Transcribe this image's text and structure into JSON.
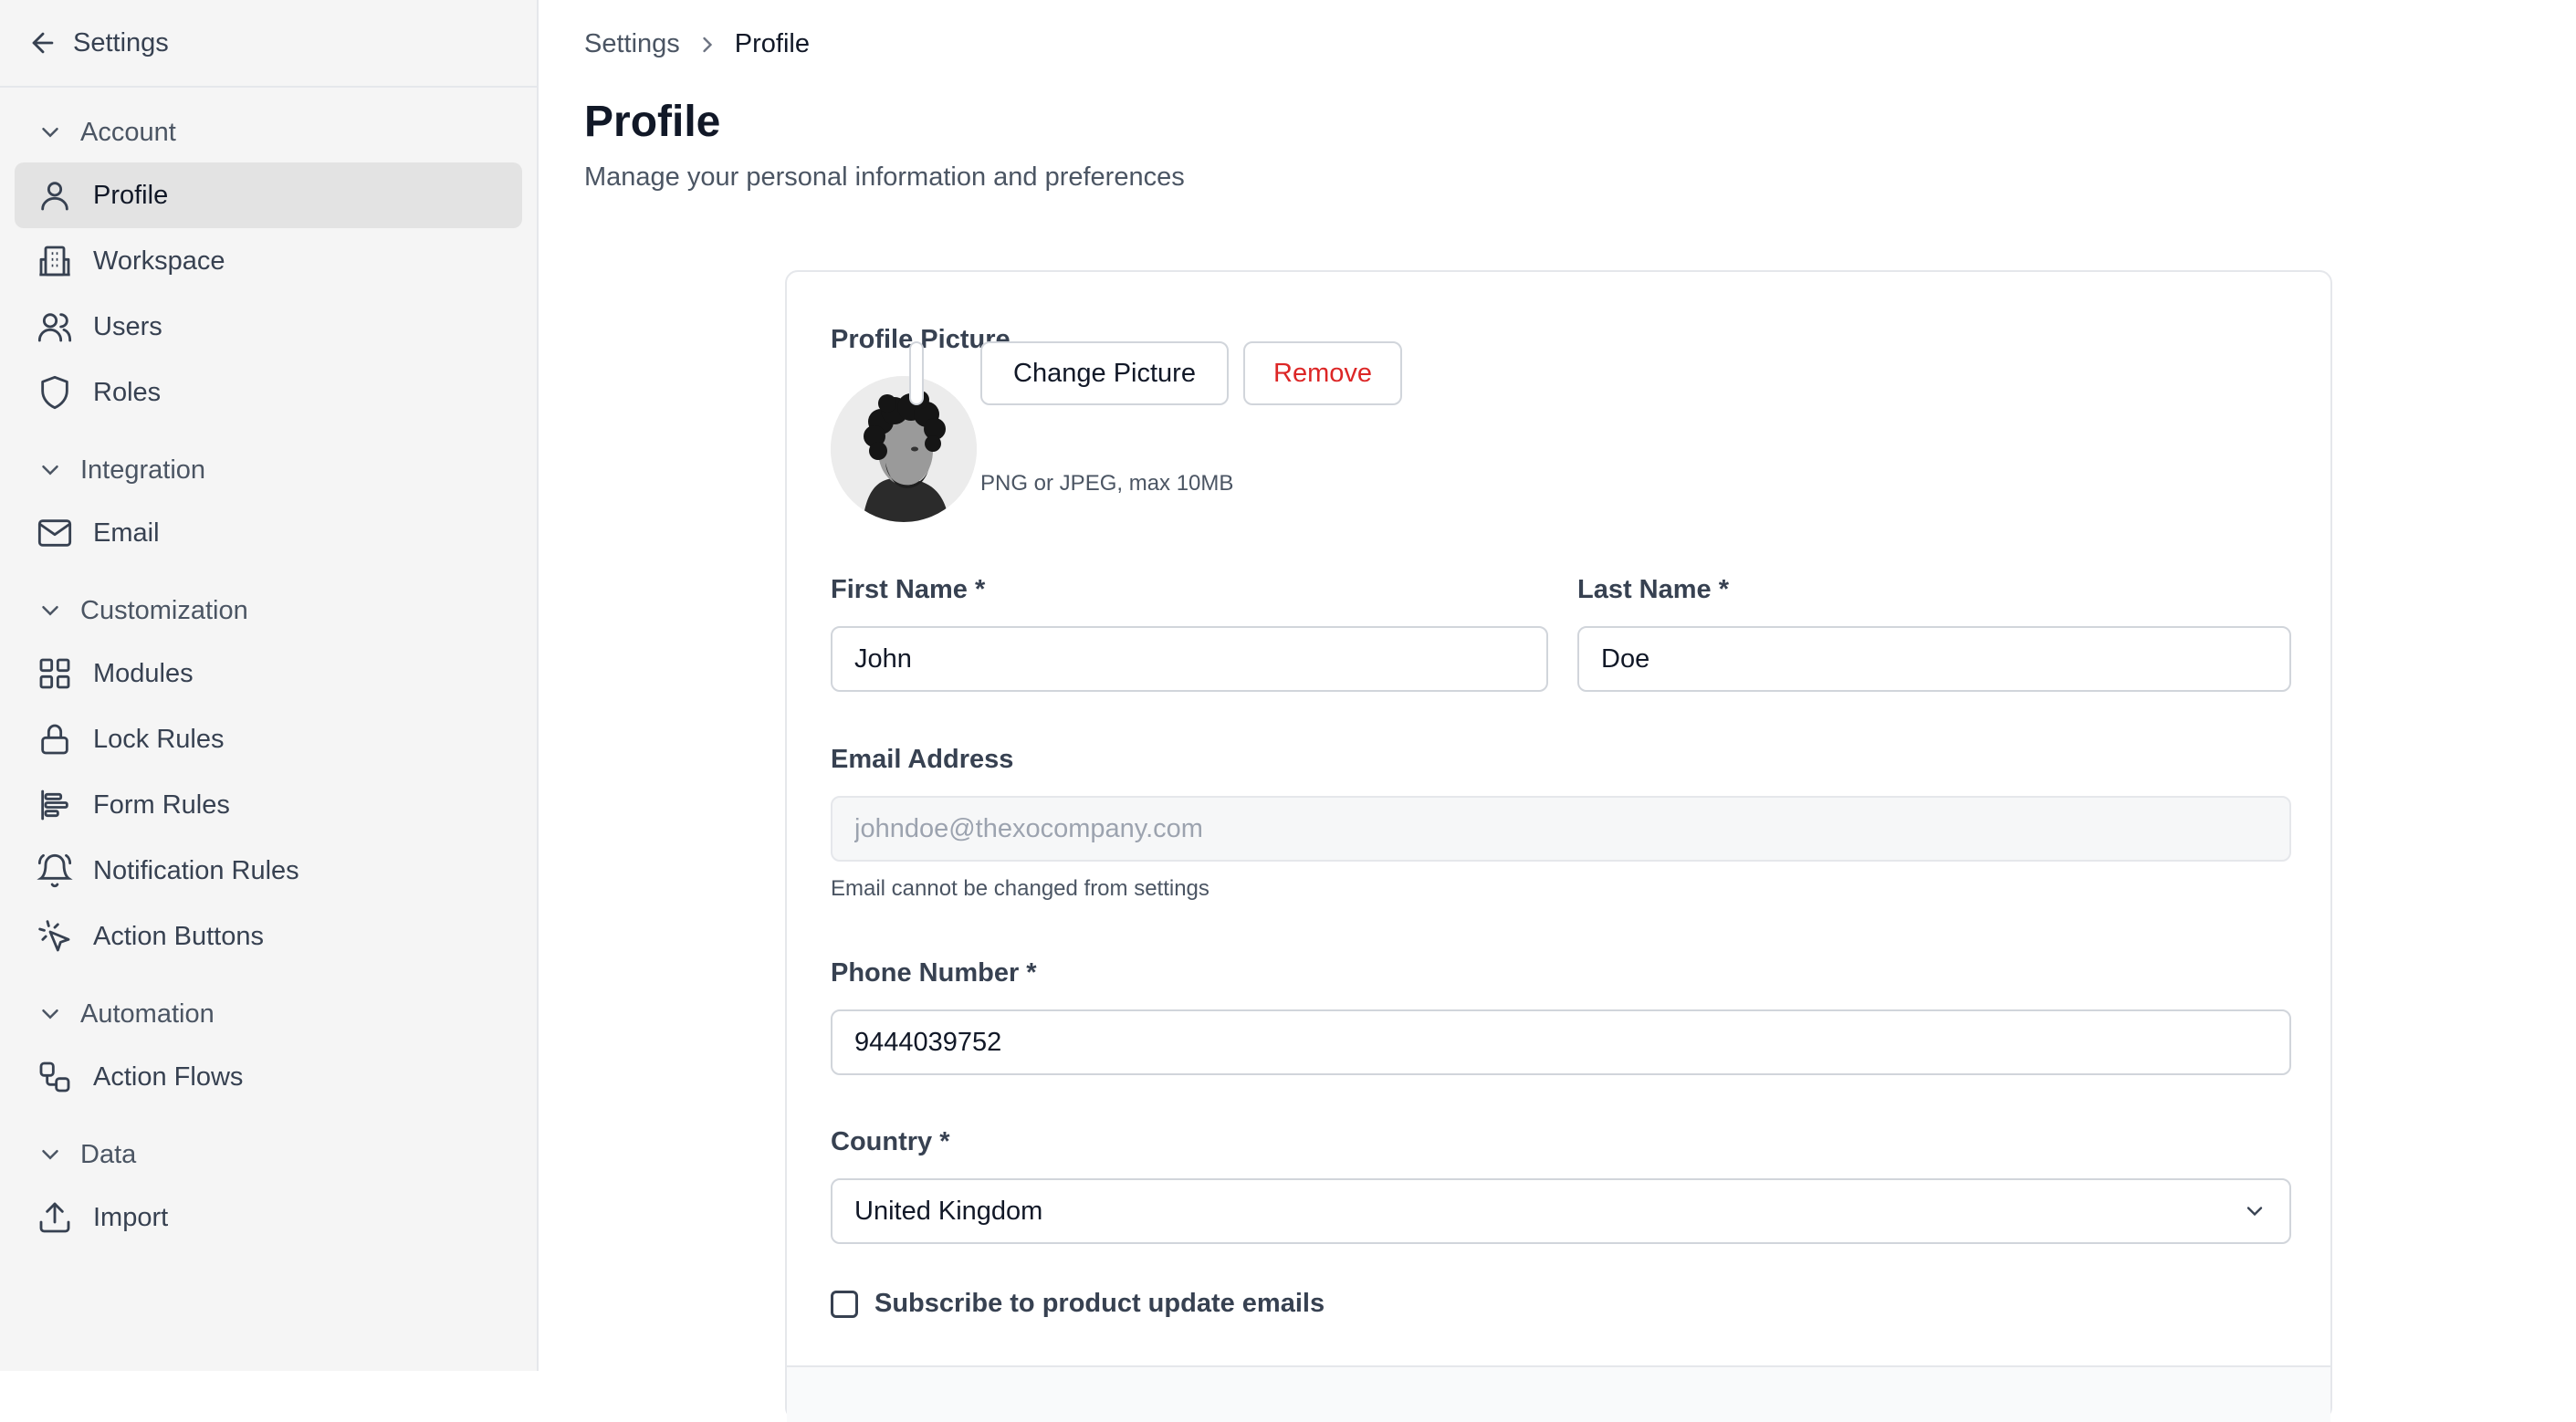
{
  "sidebar": {
    "back_label": "Settings",
    "sections": [
      {
        "label": "Account",
        "items": [
          {
            "label": "Profile",
            "icon": "user-icon",
            "active": true
          },
          {
            "label": "Workspace",
            "icon": "building-icon"
          },
          {
            "label": "Users",
            "icon": "users-icon"
          },
          {
            "label": "Roles",
            "icon": "shield-icon"
          }
        ]
      },
      {
        "label": "Integration",
        "items": [
          {
            "label": "Email",
            "icon": "mail-icon"
          }
        ]
      },
      {
        "label": "Customization",
        "items": [
          {
            "label": "Modules",
            "icon": "grid-icon"
          },
          {
            "label": "Lock Rules",
            "icon": "lock-icon"
          },
          {
            "label": "Form Rules",
            "icon": "align-left-icon"
          },
          {
            "label": "Notification Rules",
            "icon": "bell-icon"
          },
          {
            "label": "Action Buttons",
            "icon": "cursor-click-icon"
          }
        ]
      },
      {
        "label": "Automation",
        "items": [
          {
            "label": "Action Flows",
            "icon": "workflow-icon"
          }
        ]
      },
      {
        "label": "Data",
        "items": [
          {
            "label": "Import",
            "icon": "upload-icon"
          }
        ]
      }
    ]
  },
  "breadcrumb": {
    "parent": "Settings",
    "current": "Profile"
  },
  "page": {
    "title": "Profile",
    "subtitle": "Manage your personal information and preferences"
  },
  "form": {
    "picture_label": "Profile Picture",
    "change_picture": "Change Picture",
    "remove": "Remove",
    "picture_hint": "PNG or JPEG, max 10MB",
    "first_name_label": "First Name *",
    "first_name_value": "John",
    "last_name_label": "Last Name *",
    "last_name_value": "Doe",
    "email_label": "Email Address",
    "email_placeholder": "johndoe@thexocompany.com",
    "email_hint": "Email cannot be changed from settings",
    "phone_label": "Phone Number *",
    "phone_value": "9444039752",
    "country_label": "Country *",
    "country_value": "United Kingdom",
    "subscribe_label": "Subscribe to product update emails",
    "subscribe_checked": false
  },
  "colors": {
    "danger": "#dc2626",
    "active_bg": "#e3e3e3"
  }
}
